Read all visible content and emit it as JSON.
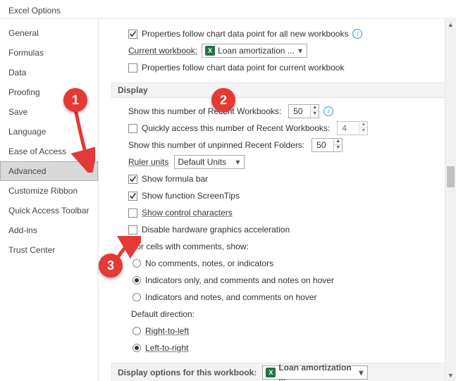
{
  "title": "Excel Options",
  "sidebar": {
    "items": [
      {
        "label": "General"
      },
      {
        "label": "Formulas"
      },
      {
        "label": "Data"
      },
      {
        "label": "Proofing"
      },
      {
        "label": "Save"
      },
      {
        "label": "Language"
      },
      {
        "label": "Ease of Access"
      },
      {
        "label": "Advanced"
      },
      {
        "label": "Customize Ribbon"
      },
      {
        "label": "Quick Access Toolbar"
      },
      {
        "label": "Add-ins"
      },
      {
        "label": "Trust Center"
      }
    ],
    "selected_index": 7
  },
  "chart_section": {
    "prop_new": "Properties follow chart data point for all new workbooks",
    "cur_wb_label": "Current workbook:",
    "cur_wb_value": "Loan amortization ...",
    "prop_cur": "Properties follow chart data point for current workbook"
  },
  "display": {
    "header": "Display",
    "recent_wb_label": "Show this number of Recent Workbooks:",
    "recent_wb_value": "50",
    "quick_access": "Quickly access this number of Recent Workbooks:",
    "quick_access_value": "4",
    "recent_fold_label": "Show this number of unpinned Recent Folders:",
    "recent_fold_value": "50",
    "ruler_label": "Ruler units",
    "ruler_value": "Default Units",
    "formula_bar": "Show formula bar",
    "screentips": "Show function ScreenTips",
    "ctrl_chars": "Show control characters",
    "hw_accel": "Disable hardware graphics acceleration",
    "comments_header": "For cells with comments, show:",
    "comments_opts": [
      "No comments, notes, or indicators",
      "Indicators only, and comments and notes on hover",
      "Indicators and notes, and comments on hover"
    ],
    "direction_header": "Default direction:",
    "dir_rtl": "Right-to-left",
    "dir_ltr": "Left-to-right"
  },
  "display_wb": {
    "header": "Display options for this workbook:",
    "value": "Loan amortization ..."
  },
  "badges": {
    "b1": "1",
    "b2": "2",
    "b3": "3"
  }
}
